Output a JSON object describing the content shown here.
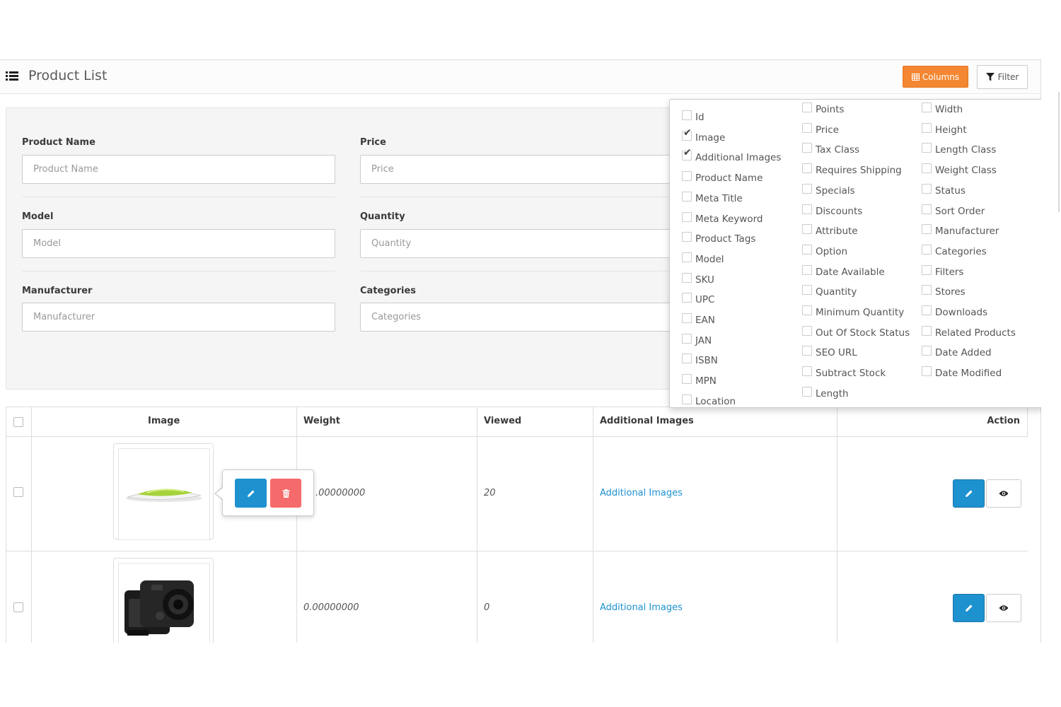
{
  "header": {
    "title": "Product List",
    "columns_label": "Columns",
    "filter_label": "Filter"
  },
  "filters": {
    "product_name": {
      "label": "Product Name",
      "placeholder": "Product Name"
    },
    "price": {
      "label": "Price",
      "placeholder": "Price"
    },
    "model": {
      "label": "Model",
      "placeholder": "Model"
    },
    "quantity": {
      "label": "Quantity",
      "placeholder": "Quantity"
    },
    "manufacturer": {
      "label": "Manufacturer",
      "placeholder": "Manufacturer"
    },
    "categories": {
      "label": "Categories",
      "placeholder": "Categories"
    }
  },
  "columns_menu": {
    "col1": [
      {
        "label": "Id",
        "checked": false
      },
      {
        "label": "Image",
        "checked": true
      },
      {
        "label": "Additional Images",
        "checked": true
      },
      {
        "label": "Product Name",
        "checked": false
      },
      {
        "label": "Meta Title",
        "checked": false
      },
      {
        "label": "Meta Keyword",
        "checked": false
      },
      {
        "label": "Product Tags",
        "checked": false
      },
      {
        "label": "Model",
        "checked": false
      },
      {
        "label": "SKU",
        "checked": false
      },
      {
        "label": "UPC",
        "checked": false
      },
      {
        "label": "EAN",
        "checked": false
      },
      {
        "label": "JAN",
        "checked": false
      },
      {
        "label": "ISBN",
        "checked": false
      },
      {
        "label": "MPN",
        "checked": false
      },
      {
        "label": "Location",
        "checked": false
      }
    ],
    "col2": [
      {
        "label": "Points",
        "checked": false
      },
      {
        "label": "Price",
        "checked": false
      },
      {
        "label": "Tax Class",
        "checked": false
      },
      {
        "label": "Requires Shipping",
        "checked": false
      },
      {
        "label": "Specials",
        "checked": false
      },
      {
        "label": "Discounts",
        "checked": false
      },
      {
        "label": "Attribute",
        "checked": false
      },
      {
        "label": "Option",
        "checked": false
      },
      {
        "label": "Date Available",
        "checked": false
      },
      {
        "label": "Quantity",
        "checked": false
      },
      {
        "label": "Minimum Quantity",
        "checked": false
      },
      {
        "label": "Out Of Stock Status",
        "checked": false
      },
      {
        "label": "SEO URL",
        "checked": false
      },
      {
        "label": "Subtract Stock",
        "checked": false
      },
      {
        "label": "Length",
        "checked": false
      }
    ],
    "col3": [
      {
        "label": "Width",
        "checked": false
      },
      {
        "label": "Height",
        "checked": false
      },
      {
        "label": "Length Class",
        "checked": false
      },
      {
        "label": "Weight Class",
        "checked": false
      },
      {
        "label": "Status",
        "checked": false
      },
      {
        "label": "Sort Order",
        "checked": false
      },
      {
        "label": "Manufacturer",
        "checked": false
      },
      {
        "label": "Categories",
        "checked": false
      },
      {
        "label": "Filters",
        "checked": false
      },
      {
        "label": "Stores",
        "checked": false
      },
      {
        "label": "Downloads",
        "checked": false
      },
      {
        "label": "Related Products",
        "checked": false
      },
      {
        "label": "Date Added",
        "checked": false
      },
      {
        "label": "Date Modified",
        "checked": false
      }
    ]
  },
  "table": {
    "headers": {
      "image": "Image",
      "weight": "Weight",
      "viewed": "Viewed",
      "additional_images": "Additional Images",
      "action": "Action"
    },
    "rows": [
      {
        "weight": ".00000000",
        "viewed": "20",
        "additional_images": "Additional Images"
      },
      {
        "weight": "0.00000000",
        "viewed": "0",
        "additional_images": "Additional Images"
      }
    ]
  },
  "colors": {
    "columns_button": "#f38733",
    "primary": "#1e91cf",
    "danger": "#f56b6b",
    "link": "#1e91cf"
  },
  "icons": [
    "list-icon",
    "table-icon",
    "filter-icon",
    "pencil-icon",
    "trash-icon",
    "eye-icon",
    "check-icon"
  ]
}
